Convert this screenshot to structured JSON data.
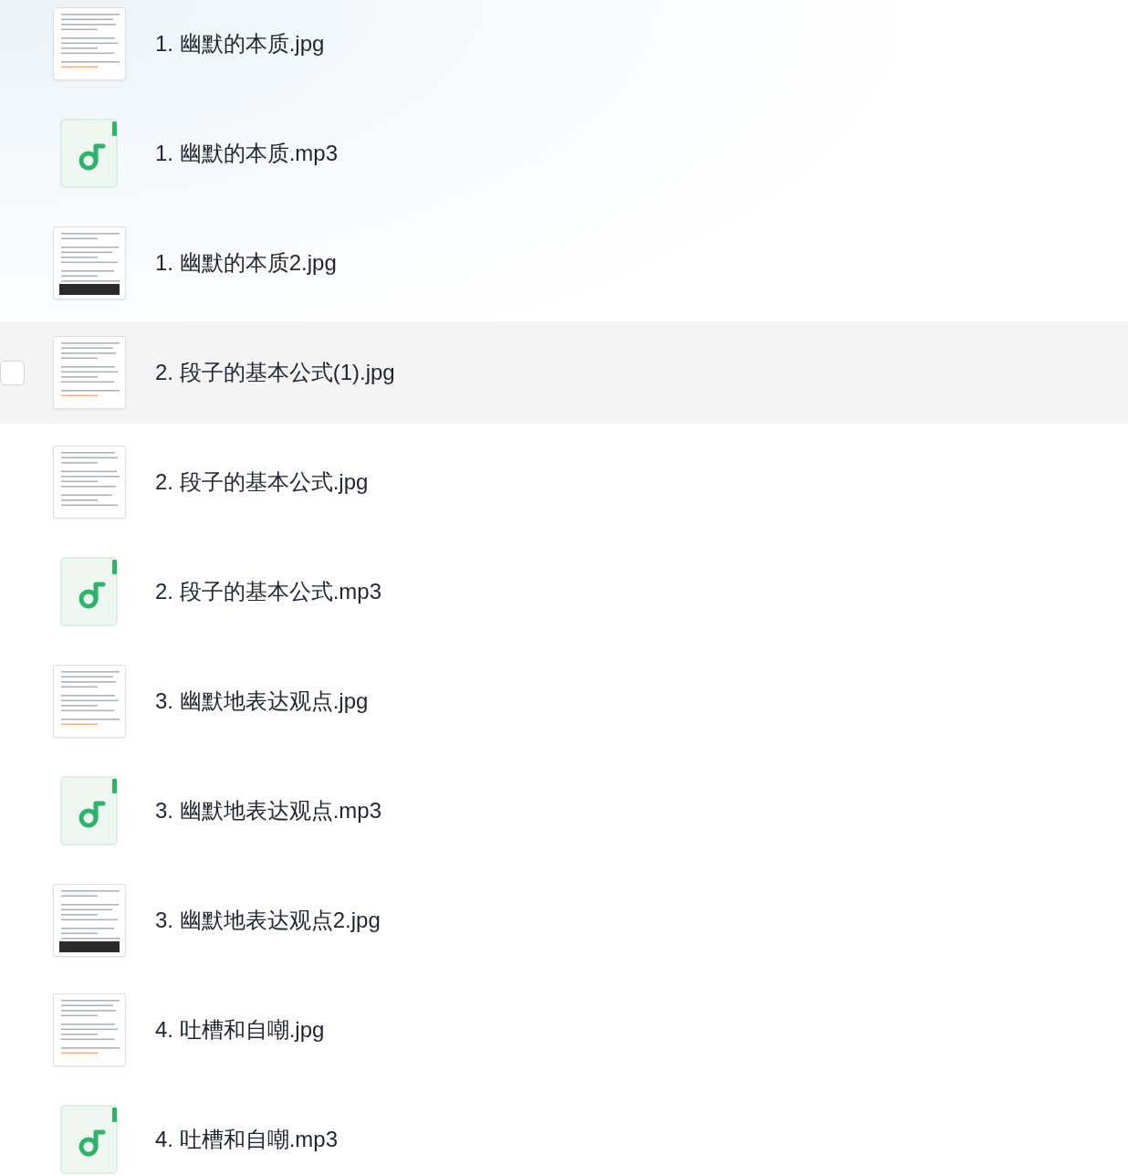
{
  "files": [
    {
      "name": "1. 幽默的本质.jpg",
      "kind": "image"
    },
    {
      "name": "1. 幽默的本质.mp3",
      "kind": "audio"
    },
    {
      "name": "1. 幽默的本质2.jpg",
      "kind": "image"
    },
    {
      "name": "2. 段子的基本公式(1).jpg",
      "kind": "image",
      "hovered": true,
      "checked": false
    },
    {
      "name": "2. 段子的基本公式.jpg",
      "kind": "image"
    },
    {
      "name": "2. 段子的基本公式.mp3",
      "kind": "audio"
    },
    {
      "name": "3. 幽默地表达观点.jpg",
      "kind": "image"
    },
    {
      "name": "3. 幽默地表达观点.mp3",
      "kind": "audio"
    },
    {
      "name": "3. 幽默地表达观点2.jpg",
      "kind": "image"
    },
    {
      "name": "4. 吐槽和自嘲.jpg",
      "kind": "image"
    },
    {
      "name": "4. 吐槽和自嘲.mp3",
      "kind": "audio"
    }
  ]
}
